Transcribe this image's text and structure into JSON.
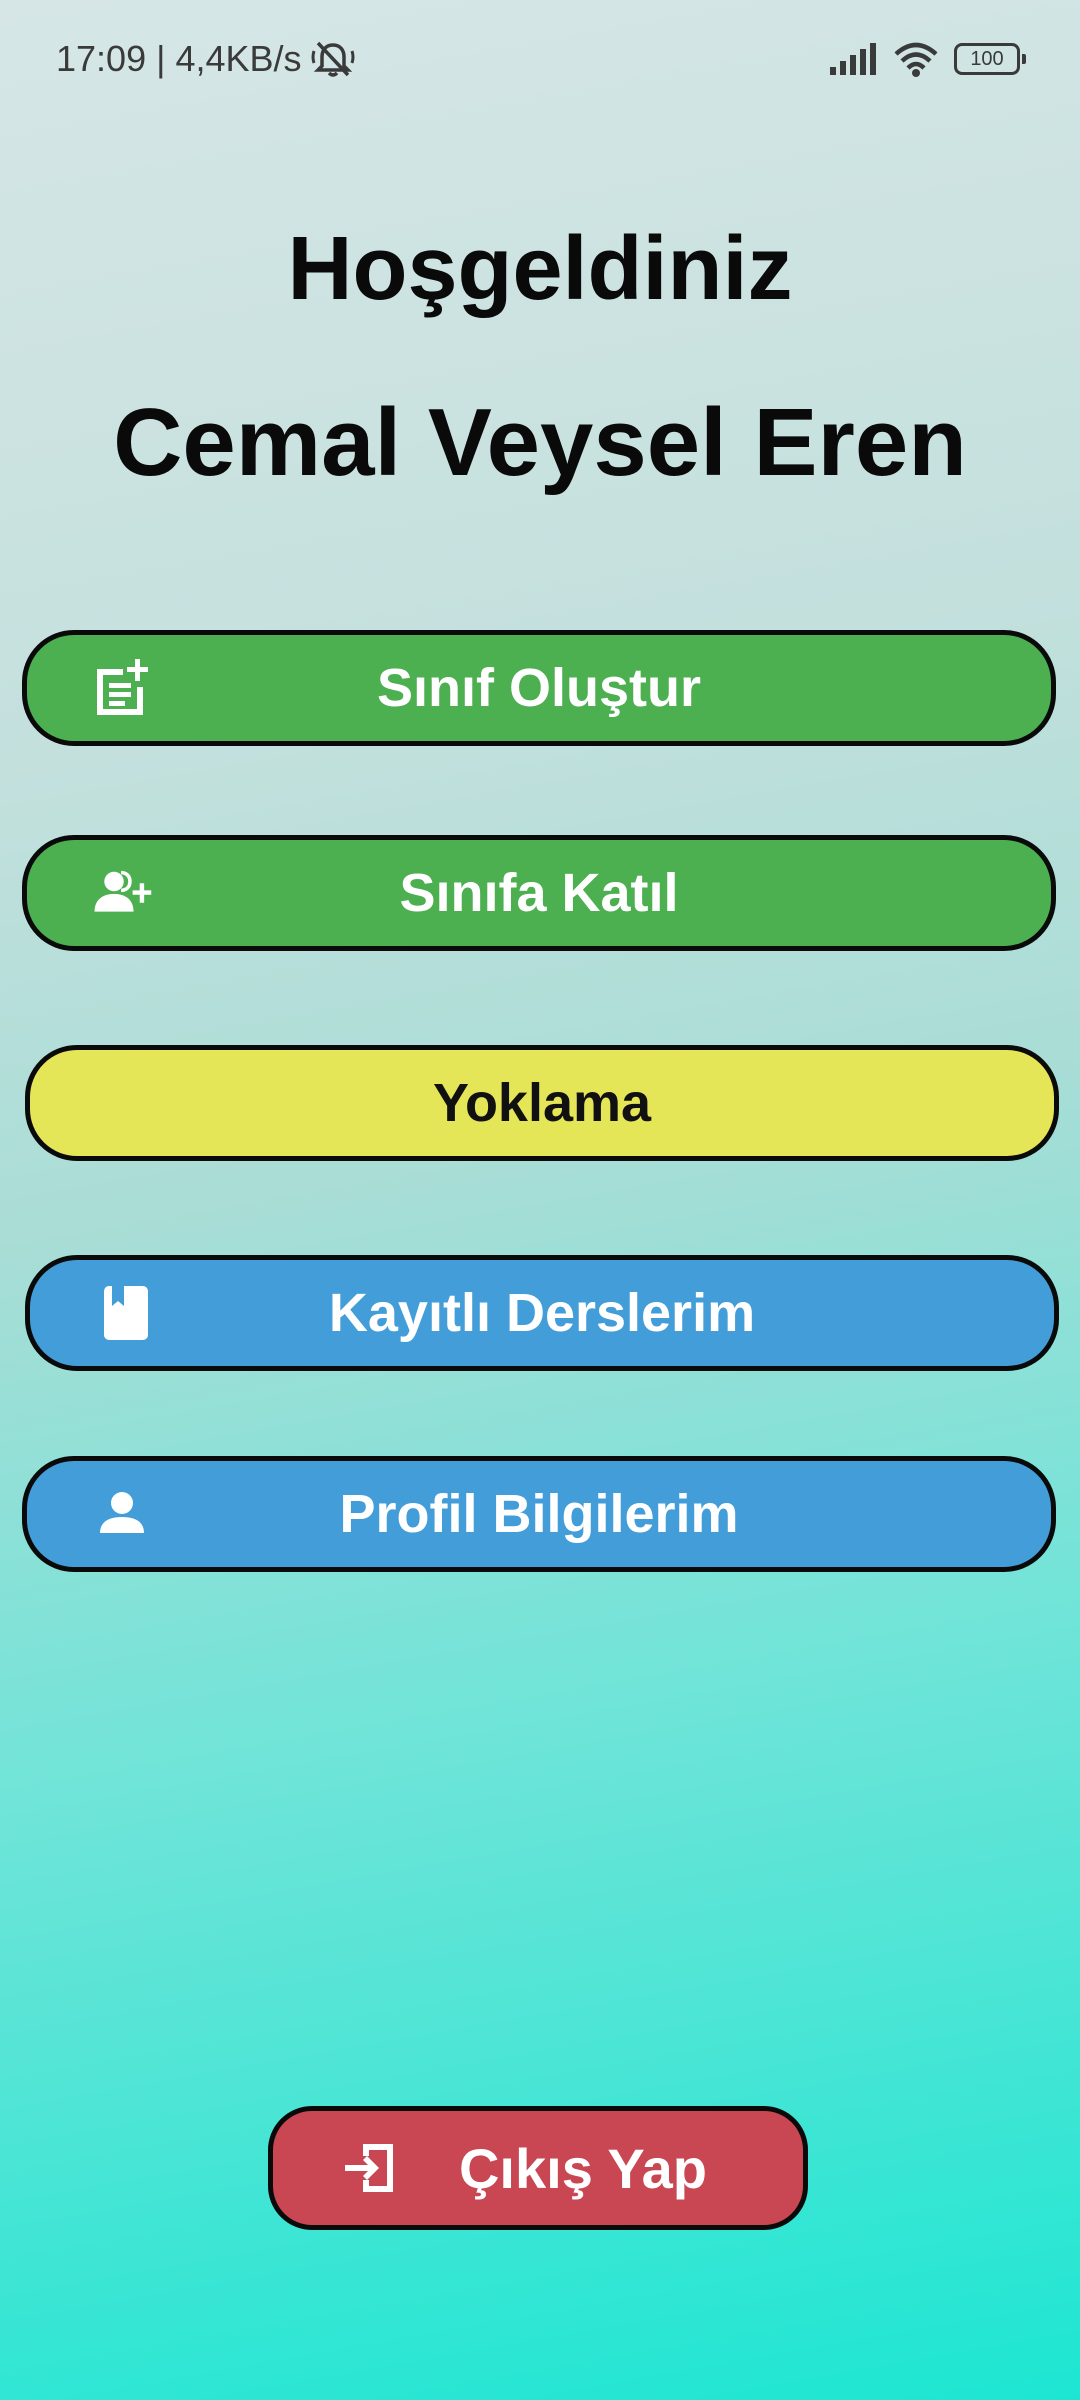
{
  "status_bar": {
    "time_speed": "17:09 | 4,4KB/s",
    "battery": "100",
    "icons": [
      "bell-off-icon",
      "signal-icon",
      "wifi-icon",
      "battery-icon"
    ]
  },
  "greeting": {
    "title": "Hoşgeldiniz",
    "name": "Cemal Veysel Eren"
  },
  "menu": {
    "create_class": {
      "label": "Sınıf Oluştur",
      "icon": "note-add-icon",
      "color": "#4caf50"
    },
    "join_class": {
      "label": "Sınıfa Katıl",
      "icon": "person-add-icon",
      "color": "#4caf50"
    },
    "attendance": {
      "label": "Yoklama",
      "color": "#e5e558"
    },
    "my_courses": {
      "label": "Kayıtlı Derslerim",
      "icon": "bookmark-book-icon",
      "color": "#439dd8"
    },
    "my_profile": {
      "label": "Profil Bilgilerim",
      "icon": "person-icon",
      "color": "#439dd8"
    }
  },
  "logout": {
    "label": "Çıkış Yap",
    "icon": "logout-icon",
    "color": "#c94653"
  }
}
